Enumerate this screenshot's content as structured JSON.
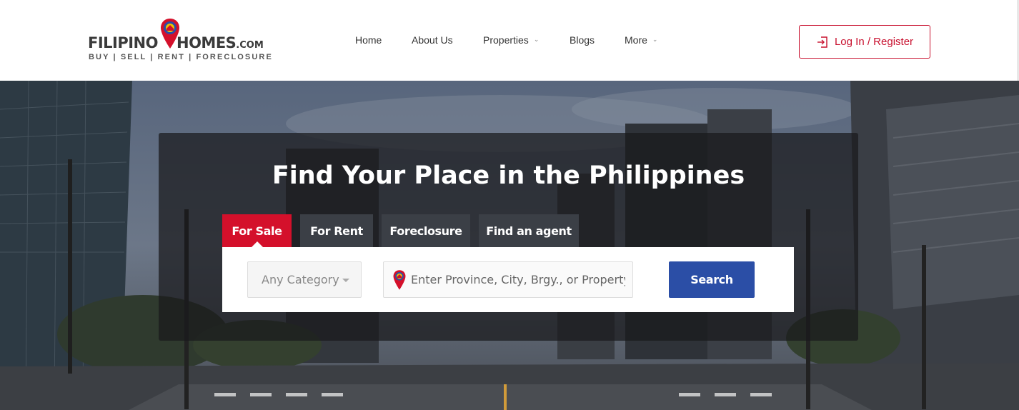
{
  "header": {
    "logo": {
      "brand_left": "FILIPINO",
      "brand_right": "HOMES",
      "brand_suffix": ".COM",
      "tagline": "BUY | SELL | RENT | FORECLOSURE"
    },
    "nav": [
      {
        "label": "Home"
      },
      {
        "label": "About Us"
      },
      {
        "label": "Properties",
        "has_dropdown": true
      },
      {
        "label": "Blogs"
      },
      {
        "label": "More",
        "has_dropdown": true
      }
    ],
    "login_label": "Log In / Register",
    "login_icon": "login-icon",
    "accent_color": "#c8102e"
  },
  "hero": {
    "title": "Find Your Place in the Philippines",
    "tabs": [
      {
        "label": "For Sale",
        "active": true
      },
      {
        "label": "For Rent",
        "active": false
      },
      {
        "label": "Foreclosure",
        "active": false
      },
      {
        "label": "Find an agent",
        "active": false
      }
    ],
    "category_select": {
      "selected": "Any Category"
    },
    "location_input": {
      "placeholder": "Enter Province, City, Brgy., or Property co",
      "value": ""
    },
    "search_label": "Search",
    "search_color": "#2b4ea6",
    "active_tab_color": "#d4102b"
  }
}
